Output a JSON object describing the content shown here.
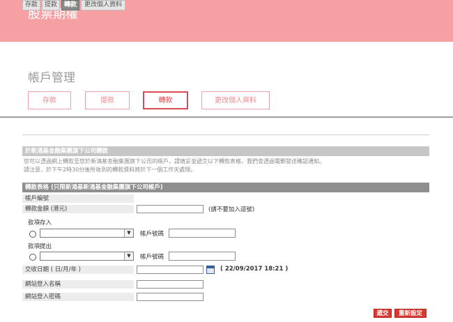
{
  "banner": {
    "title": "股票期權"
  },
  "section": {
    "title": "帳戶管理"
  },
  "big_tabs": [
    "存款",
    "提款",
    "轉款",
    "更改個人資料"
  ],
  "small_tabs": [
    "存款",
    "提款",
    "轉款",
    "更改個人資料"
  ],
  "notice": {
    "title": "於新鴻基金融集團旗下公司轉款",
    "line1": "您可以透過網上轉款至您於新鴻基金融集團旗下公司的帳戶，請填妥並遞交以下轉款表格，我們會透過電郵發送確認通知。",
    "line2": "請注意，於下午2時30分後所收到的轉款資料將於下一個工作天處理。"
  },
  "form": {
    "title": "轉款表格 (只限新鴻基新鴻基金融集團旗下公司帳戶)",
    "account_no_label": "帳戶編號",
    "amount_label": "轉款金額 (港元)",
    "amount_hint": "(請不要加入逗號)",
    "deposit_label": "款項存入",
    "withdraw_label": "款項提出",
    "account_number_label": "帳戶號碼",
    "date_label": "交收日期 ( 日/月/年 )",
    "date_hint": "( 22/09/2017 18:21 )",
    "login_name_label": "網站登入名稱",
    "login_password_label": "網站登入密碼"
  },
  "buttons": {
    "submit": "遞交",
    "reset": "重新設定"
  }
}
